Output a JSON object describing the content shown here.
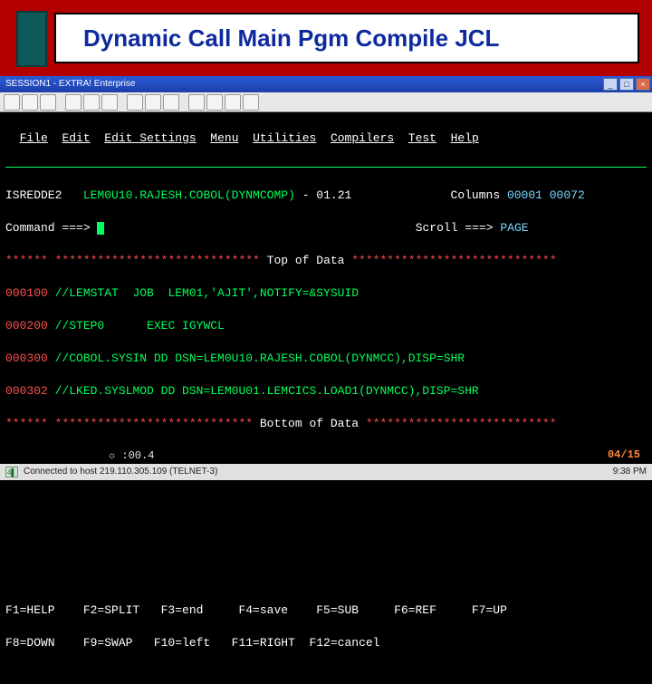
{
  "slide": {
    "title": "Dynamic Call Main Pgm Compile JCL",
    "counter": "04/15"
  },
  "window": {
    "title": "SESSION1 - EXTRA! Enterprise",
    "min": "_",
    "max": "□",
    "close": "×"
  },
  "menu": {
    "file": "File",
    "edit": "Edit",
    "edit_settings": "Edit_Settings",
    "menu": "Menu",
    "utilities": "Utilities",
    "compilers": "Compilers",
    "test": "Test",
    "help": "Help"
  },
  "editor": {
    "panel_id": "ISREDDE2",
    "dataset": "LEM0U10.RAJESH.COBOL(DYNMCOMP)",
    "member_ver": "- 01.21",
    "columns_label": "Columns",
    "columns_value": "00001 00072",
    "command_label": "Command ===>",
    "scroll_label": "Scroll ===>",
    "scroll_value": "PAGE",
    "top_stars_left": "****** *****************************",
    "top_label": " Top of Data ",
    "top_stars_right": "*****************************",
    "bottom_stars_left": "****** ****************************",
    "bottom_label": " Bottom of Data ",
    "bottom_stars_right": "***************************",
    "lines": [
      {
        "num": "000100",
        "text": "//LEMSTAT  JOB  LEM01,'AJIT',NOTIFY=&SYSUID"
      },
      {
        "num": "000200",
        "text": "//STEP0      EXEC IGYWCL"
      },
      {
        "num": "000300",
        "text": "//COBOL.SYSIN DD DSN=LEM0U10.RAJESH.COBOL(DYNMCC),DISP=SHR"
      },
      {
        "num": "000302",
        "text": "//LKED.SYSLMOD DD DSN=LEM0U01.LEMCICS.LOAD1(DYNMCC),DISP=SHR"
      }
    ]
  },
  "fkeys": {
    "row1": "F1=HELP    F2=SPLIT   F3=end     F4=save    F5=SUB     F6=REF     F7=UP",
    "row2": "F8=DOWN    F9=SWAP   F10=left   F11=RIGHT  F12=cancel"
  },
  "oia": {
    "indicator": "4▌",
    "clock": "☼ :00.4"
  },
  "statusbar": {
    "text": "Connected to host 219.110.305.109 (TELNET-3)",
    "time": "9:38 PM"
  }
}
